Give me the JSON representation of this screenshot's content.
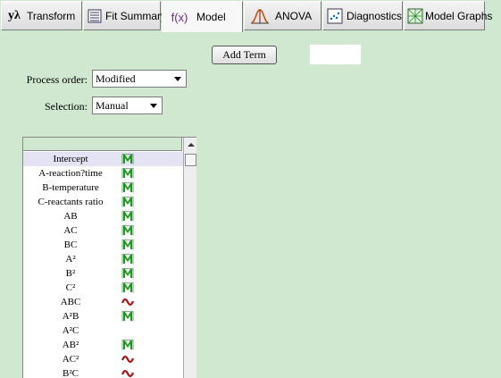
{
  "tabs": [
    {
      "label": "Transform",
      "icon": "lambda-icon"
    },
    {
      "label": "Fit Summary",
      "icon": "list-icon"
    },
    {
      "label": "Model",
      "icon": "function-icon"
    },
    {
      "label": "ANOVA",
      "icon": "distribution-icon"
    },
    {
      "label": "Diagnostics",
      "icon": "scatter-icon"
    },
    {
      "label": "Model Graphs",
      "icon": "surface-icon"
    }
  ],
  "tab_icon_text": {
    "transform": "yλ",
    "model": "f(x)"
  },
  "active_tab": "Model",
  "add_term_label": "Add Term",
  "process_order": {
    "label": "Process order:",
    "value": "Modified"
  },
  "selection": {
    "label": "Selection:",
    "value": "Manual"
  },
  "terms": [
    {
      "name": "Intercept",
      "status": "M"
    },
    {
      "name": "A-reaction?time",
      "status": "M"
    },
    {
      "name": "B-temperature",
      "status": "M"
    },
    {
      "name": "C-reactants ratio",
      "status": "M"
    },
    {
      "name": "AB",
      "status": "M"
    },
    {
      "name": "AC",
      "status": "M"
    },
    {
      "name": "BC",
      "status": "M"
    },
    {
      "name": "A²",
      "status": "M"
    },
    {
      "name": "B²",
      "status": "M"
    },
    {
      "name": "C²",
      "status": "M"
    },
    {
      "name": "ABC",
      "status": "~"
    },
    {
      "name": "A²B",
      "status": "M"
    },
    {
      "name": "A²C",
      "status": ""
    },
    {
      "name": "AB²",
      "status": "M"
    },
    {
      "name": "AC²",
      "status": "~"
    },
    {
      "name": "B²C",
      "status": "~"
    }
  ],
  "colors": {
    "model_term": "#1a9a1a",
    "aliased_term": "#b01010",
    "background": "#cfe8cf"
  }
}
